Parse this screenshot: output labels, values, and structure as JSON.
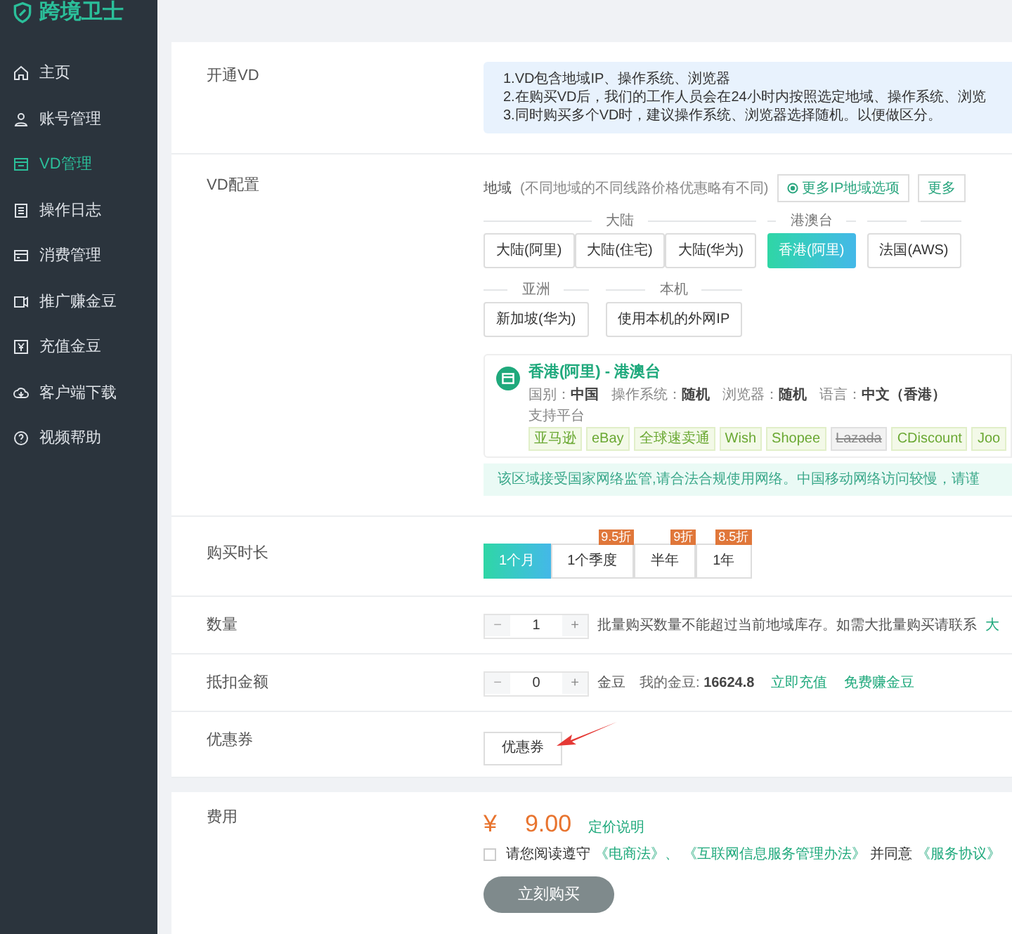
{
  "sidebar": {
    "logo": "跨境卫士",
    "items": [
      {
        "label": "主页",
        "selected": false
      },
      {
        "label": "账号管理",
        "selected": false
      },
      {
        "label": "VD管理",
        "selected": true
      },
      {
        "label": "操作日志",
        "selected": false
      },
      {
        "label": "消费管理",
        "selected": false
      },
      {
        "label": "推广赚金豆",
        "selected": false
      },
      {
        "label": "充值金豆",
        "selected": false
      },
      {
        "label": "客户端下载",
        "selected": false
      },
      {
        "label": "视频帮助",
        "selected": false
      }
    ]
  },
  "open_vd": {
    "label": "开通VD",
    "notes": [
      "1.VD包含地域IP、操作系统、浏览器",
      "2.在购买VD后，我们的工作人员会在24小时内按照选定地域、操作系统、浏览",
      "3.同时购买多个VD时，建议操作系统、浏览器选择随机。以便做区分。"
    ]
  },
  "vd_config": {
    "label": "VD配置",
    "region_label": "地域",
    "region_hint": "(不同地域的不同线路价格优惠略有不同)",
    "more_buttons": [
      "更多IP地域选项",
      "更多"
    ],
    "groups": [
      {
        "title": "大陆",
        "options": [
          {
            "label": "大陆(阿里)",
            "selected": false
          },
          {
            "label": "大陆(住宅)",
            "selected": false
          },
          {
            "label": "大陆(华为)",
            "selected": false
          }
        ]
      },
      {
        "title": "港澳台",
        "options": [
          {
            "label": "香港(阿里)",
            "selected": true
          }
        ]
      },
      {
        "options": [
          {
            "label": "法国(AWS)",
            "selected": false
          }
        ]
      },
      {
        "title": "亚洲",
        "options": [
          {
            "label": "新加坡(华为)",
            "selected": false
          }
        ]
      },
      {
        "title": "本机",
        "options": [
          {
            "label": "使用本机的外网IP",
            "selected": false
          }
        ]
      }
    ],
    "info": {
      "title": "香港(阿里) - 港澳台",
      "specs": [
        {
          "key": "国别：",
          "value": "中国"
        },
        {
          "key": "操作系统：",
          "value": "随机"
        },
        {
          "key": "浏览器：",
          "value": "随机"
        },
        {
          "key": "语言：",
          "value": "中文（香港）"
        }
      ],
      "platforms_label": "支持平台",
      "platforms": [
        {
          "label": "亚马逊",
          "disabled": false
        },
        {
          "label": "eBay",
          "disabled": false
        },
        {
          "label": "全球速卖通",
          "disabled": false
        },
        {
          "label": "Wish",
          "disabled": false
        },
        {
          "label": "Shopee",
          "disabled": false
        },
        {
          "label": "Lazada",
          "disabled": true
        },
        {
          "label": "CDiscount",
          "disabled": false
        },
        {
          "label": "Joo",
          "disabled": false
        }
      ]
    },
    "notice": "该区域接受国家网络监管,请合法合规使用网络。中国移动网络访问较慢，请谨"
  },
  "duration": {
    "label": "购买时长",
    "options": [
      {
        "label": "1个月",
        "selected": true
      },
      {
        "label": "1个季度",
        "badge": "9.5折",
        "selected": false
      },
      {
        "label": "半年",
        "badge": "9折",
        "selected": false
      },
      {
        "label": "1年",
        "badge": "8.5折",
        "selected": false
      }
    ]
  },
  "quantity": {
    "label": "数量",
    "minus": "−",
    "value": "1",
    "plus": "+",
    "hint": "批量购买数量不能超过当前地域库存。如需大批量购买请联系",
    "link": "大"
  },
  "deduction": {
    "label": "抵扣金额",
    "minus": "−",
    "value": "0",
    "plus": "+",
    "unit": "金豆",
    "balance_label": "我的金豆:",
    "balance": "16624.8",
    "links": [
      "立即充值",
      "免费赚金豆"
    ]
  },
  "coupon": {
    "label": "优惠券",
    "button": "优惠券"
  },
  "fee": {
    "label": "费用",
    "currency": "¥",
    "amount": "9.00",
    "pricing_link": "定价说明",
    "agree_checked": false,
    "agree_text": "请您阅读遵守",
    "law_links": [
      "《电商法》、",
      "《互联网信息服务管理办法》"
    ],
    "agree_mid": "并同意",
    "service_link": "《服务协议》",
    "buy_button": "立刻购买"
  }
}
